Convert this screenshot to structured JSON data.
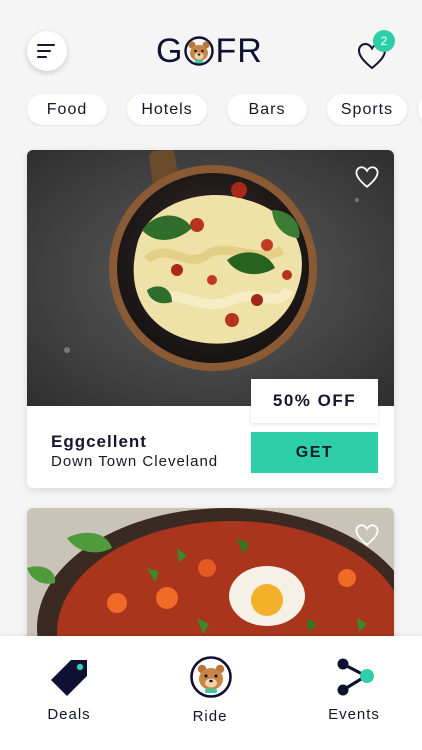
{
  "app": {
    "logo_text_left": "G",
    "logo_text_right": "FR"
  },
  "header": {
    "favorites_count": "2"
  },
  "categories": [
    {
      "label": "Food"
    },
    {
      "label": "Hotels"
    },
    {
      "label": "Bars"
    },
    {
      "label": "Sports"
    }
  ],
  "deals": [
    {
      "title": "Eggcellent",
      "location": "Down Town Cleveland",
      "discount": "50% OFF",
      "cta": "GET"
    }
  ],
  "tabbar": {
    "items": [
      {
        "label": "Deals",
        "icon": "price-tag-icon"
      },
      {
        "label": "Ride",
        "icon": "bear-avatar-icon"
      },
      {
        "label": "Events",
        "icon": "share-nodes-icon"
      }
    ]
  },
  "colors": {
    "accent": "#2ecfa8",
    "text": "#16162e",
    "background": "#f5f5f5"
  }
}
